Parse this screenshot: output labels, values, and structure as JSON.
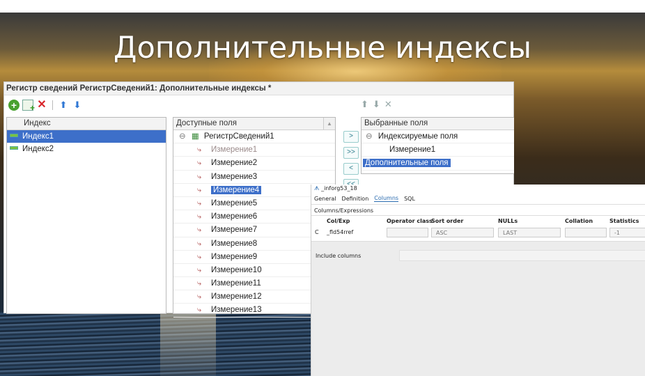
{
  "slide": {
    "title": "Дополнительные индексы"
  },
  "window1c": {
    "title": "Регистр сведений РегистрСведений1: Дополнительные индексы *",
    "index_panel": {
      "header": "Индекс",
      "items": [
        "Индекс1",
        "Индекс2"
      ],
      "selected": "Индекс1"
    },
    "available_panel": {
      "header": "Доступные поля",
      "root": "РегистрСведений1",
      "items": [
        "Измерение1",
        "Измерение2",
        "Измерение3",
        "Измерение4",
        "Измерение5",
        "Измерение6",
        "Измерение7",
        "Измерение8",
        "Измерение9",
        "Измерение10",
        "Измерение11",
        "Измерение12",
        "Измерение13"
      ],
      "selected": "Измерение4"
    },
    "transfer_buttons": [
      ">",
      ">>",
      "<",
      "<<"
    ],
    "selected_panel": {
      "header": "Выбранные поля",
      "group": "Индексируемые поля",
      "group_item": "Измерение1",
      "extra": "Дополнительные поля"
    }
  },
  "pgadmin": {
    "title": "_inforg53_18",
    "tabs": [
      "General",
      "Definition",
      "Columns",
      "SQL"
    ],
    "active_tab": "Columns",
    "section": "Columns/Expressions",
    "columns": [
      "Col/Exp",
      "Operator class",
      "Sort order",
      "NULLs",
      "Collation",
      "Statistics"
    ],
    "row": {
      "marker": "C",
      "col_exp": "_fld54rref",
      "operator_class": "",
      "sort_order": "ASC",
      "nulls": "LAST",
      "collation": "",
      "statistics": "-1"
    },
    "include_label": "Include columns"
  }
}
